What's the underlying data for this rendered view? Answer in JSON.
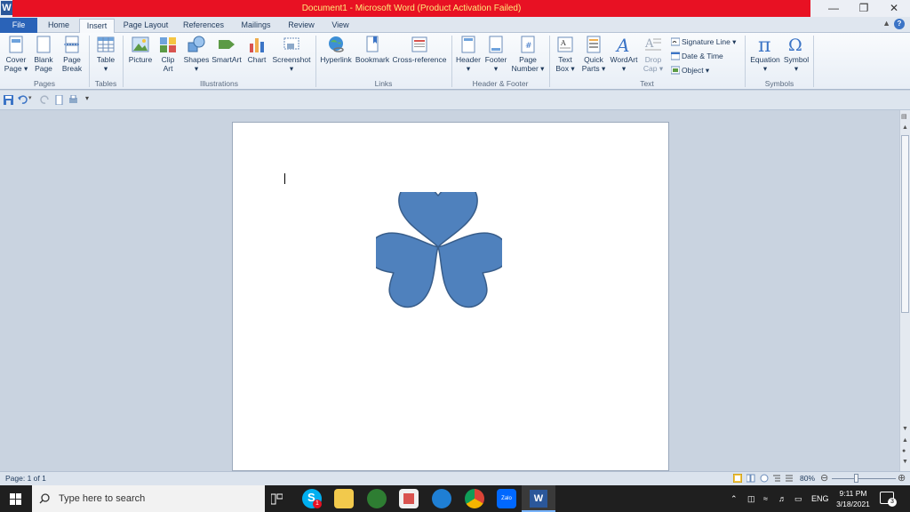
{
  "window": {
    "title": "Document1 - Microsoft Word (Product Activation Failed)",
    "app_logo": "W",
    "minimize": "—",
    "restore": "❐",
    "close": "✕"
  },
  "tabs": [
    {
      "label": "File"
    },
    {
      "label": "Home"
    },
    {
      "label": "Insert"
    },
    {
      "label": "Page Layout"
    },
    {
      "label": "References"
    },
    {
      "label": "Mailings"
    },
    {
      "label": "Review"
    },
    {
      "label": "View"
    }
  ],
  "ribbon": {
    "buttons": [
      {
        "line1": "Cover",
        "line2": "Page ▾"
      },
      {
        "line1": "Blank",
        "line2": "Page"
      },
      {
        "line1": "Page",
        "line2": "Break"
      },
      {
        "line1": "Table",
        "line2": "▾"
      },
      {
        "line1": "Picture",
        "line2": ""
      },
      {
        "line1": "Clip",
        "line2": "Art"
      },
      {
        "line1": "Shapes",
        "line2": "▾"
      },
      {
        "line1": "SmartArt",
        "line2": ""
      },
      {
        "line1": "Chart",
        "line2": ""
      },
      {
        "line1": "Screenshot",
        "line2": "▾"
      },
      {
        "line1": "Hyperlink",
        "line2": ""
      },
      {
        "line1": "Bookmark",
        "line2": ""
      },
      {
        "line1": "Cross-reference",
        "line2": ""
      },
      {
        "line1": "Header",
        "line2": "▾"
      },
      {
        "line1": "Footer",
        "line2": "▾"
      },
      {
        "line1": "Page",
        "line2": "Number ▾"
      },
      {
        "line1": "Text",
        "line2": "Box ▾"
      },
      {
        "line1": "Quick",
        "line2": "Parts ▾"
      },
      {
        "line1": "WordArt",
        "line2": "▾"
      },
      {
        "line1": "Drop",
        "line2": "Cap ▾"
      },
      {
        "line1": "Equation",
        "line2": "▾"
      },
      {
        "line1": "Symbol",
        "line2": "▾"
      }
    ],
    "small_items": [
      {
        "label": "Signature Line ▾"
      },
      {
        "label": "Date & Time"
      },
      {
        "label": "Object ▾"
      }
    ],
    "groups": [
      "Pages",
      "Tables",
      "Illustrations",
      "Links",
      "Header & Footer",
      "Text",
      "Symbols"
    ]
  },
  "document": {
    "shape_color": "#4f81bd",
    "shape_outline": "#385d8a"
  },
  "status": {
    "page": "Page: 1 of 1",
    "zoom": "80%"
  },
  "taskbar": {
    "search_placeholder": "Type here to search",
    "skype_badge": "1",
    "zalo": "Zalo",
    "time": "9:11 PM",
    "date": "3/18/2021",
    "lang": "ENG",
    "notif": "3"
  }
}
